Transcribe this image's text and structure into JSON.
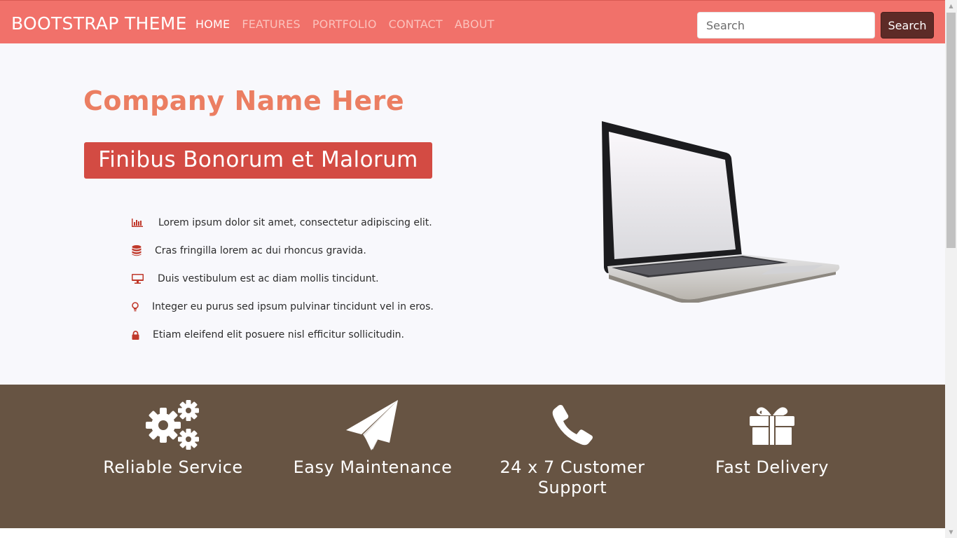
{
  "navbar": {
    "brand": "BOOTSTRAP THEME",
    "links": [
      "HOME",
      "FEATURES",
      "PORTFOLIO",
      "CONTACT",
      "ABOUT"
    ],
    "active_link": "HOME",
    "search": {
      "placeholder": "Search",
      "value": "",
      "button_label": "Search"
    },
    "colors": {
      "background": "#f1716a",
      "button": "#5d2b27"
    }
  },
  "hero": {
    "company_name": "Company Name Here",
    "banner": "Finibus Bonorum et Malorum",
    "features": [
      {
        "icon": "bar-chart-icon",
        "text": "Lorem ipsum dolor sit amet, consectetur adipiscing elit."
      },
      {
        "icon": "database-icon",
        "text": "Cras fringilla lorem ac dui rhoncus gravida."
      },
      {
        "icon": "monitor-icon",
        "text": "Duis vestibulum est ac diam mollis tincidunt."
      },
      {
        "icon": "lightbulb-icon",
        "text": "Integer eu purus sed ipsum pulvinar tincidunt vel in eros."
      },
      {
        "icon": "lock-icon",
        "text": "Etiam eleifend elit posuere nisl efficitur sollicitudin."
      }
    ],
    "image": "laptop-image",
    "colors": {
      "title": "#eb7e62",
      "banner": "#d34b43",
      "icon": "#c0392b"
    }
  },
  "services": {
    "items": [
      {
        "icon": "gears-icon",
        "label": "Reliable Service"
      },
      {
        "icon": "paper-plane-icon",
        "label": "Easy Maintenance"
      },
      {
        "icon": "phone-icon",
        "label": "24 x 7 Customer Support"
      },
      {
        "icon": "gift-icon",
        "label": "Fast Delivery"
      }
    ],
    "colors": {
      "background": "#675443"
    }
  }
}
